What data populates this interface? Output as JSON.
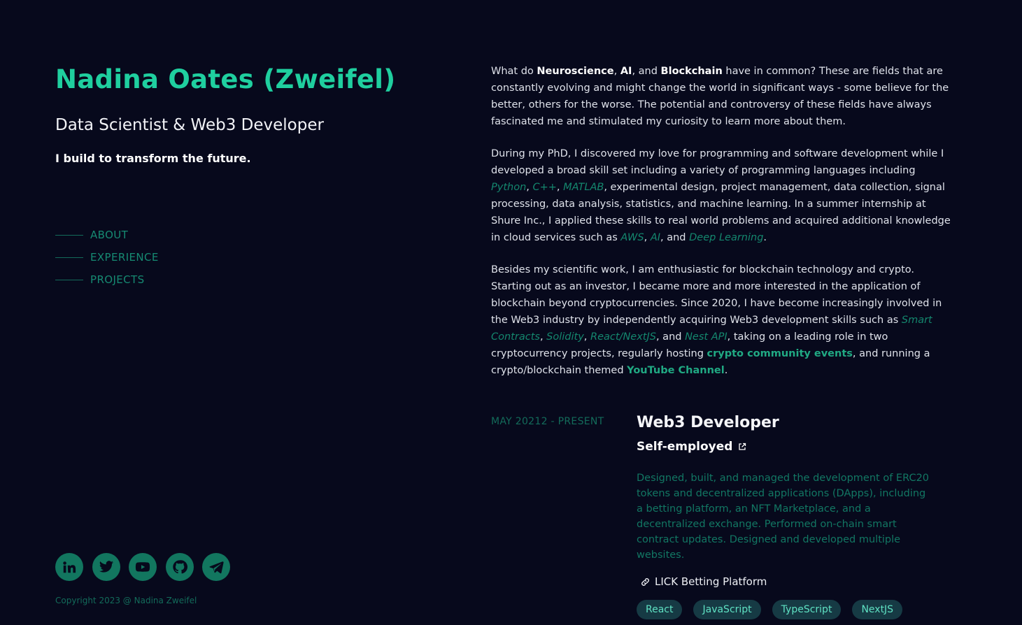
{
  "profile": {
    "name": "Nadina Oates (Zweifel)",
    "role": "Data Scientist & Web3 Developer",
    "tagline": "I build to transform the future."
  },
  "nav": {
    "items": [
      {
        "label": "ABOUT"
      },
      {
        "label": "EXPERIENCE"
      },
      {
        "label": "PROJECTS"
      }
    ]
  },
  "socials": [
    {
      "icon": "linkedin-icon"
    },
    {
      "icon": "twitter-icon"
    },
    {
      "icon": "youtube-icon"
    },
    {
      "icon": "github-icon"
    },
    {
      "icon": "telegram-icon"
    }
  ],
  "footer": {
    "copyright": "Copyright 2023 @ Nadina Zweifel"
  },
  "about": {
    "p1": {
      "t1": "What do ",
      "b1": "Neuroscience",
      "t2": ", ",
      "b2": "AI",
      "t3": ", and ",
      "b3": "Blockchain",
      "t4": " have in common? These are fields that are constantly evolving and might change the world in significant ways - some believe for the better, others for the worse. The potential and controversy of these fields have always fascinated me and stimulated my curiosity to learn more about them."
    },
    "p2": {
      "t1": "During my PhD, I discovered my love for programming and software development while I developed a broad skill set including a variety of programming languages including ",
      "k1": "Python",
      "t2": ", ",
      "k2": "C++",
      "t3": ", ",
      "k3": "MATLAB",
      "t4": ", experimental design, project management, data collection, signal processing, data analysis, statistics, and machine learning. In a summer internship at Shure Inc., I applied these skills to real world problems and acquired additional knowledge in cloud services such as ",
      "k4": "AWS",
      "t5": ", ",
      "k5": "AI",
      "t6": ", and ",
      "k6": "Deep Learning",
      "t7": "."
    },
    "p3": {
      "t1": "Besides my scientific work, I am enthusiastic for blockchain technology and crypto. Starting out as an investor, I became more and more interested in the application of blockchain beyond cryptocurrencies. Since 2020, I have become increasingly involved in the Web3 industry by independently acquiring Web3 development skills such as ",
      "k1": "Smart Contracts",
      "t2": ", ",
      "k2": "Solidity",
      "t3": ", ",
      "k3": "React/NextJS",
      "t4": ", and ",
      "k4": "Nest API",
      "t5": ", taking on a leading role in two cryptocurrency projects, regularly hosting ",
      "l1": "crypto community events",
      "t6": ", and running a crypto/blockchain themed ",
      "l2": "YouTube Channel",
      "t7": "."
    }
  },
  "experience": {
    "date": "MAY 20212 - PRESENT",
    "title": "Web3 Developer",
    "company": "Self-employed",
    "description": "Designed, built, and managed the development of ERC20 tokens and decentralized applications (DApps), including a betting platform, an NFT Marketplace, and a decentralized exchange. Performed on-chain smart contract updates. Designed and developed multiple websites.",
    "link": "LICK Betting Platform",
    "tags": [
      "React",
      "JavaScript",
      "TypeScript",
      "NextJS"
    ]
  },
  "colors": {
    "background": "#07091c",
    "accent": "#1fcf9f",
    "muted_accent": "#136b5a",
    "tag_bg": "#163a44",
    "tag_text": "#5fe1c3"
  }
}
